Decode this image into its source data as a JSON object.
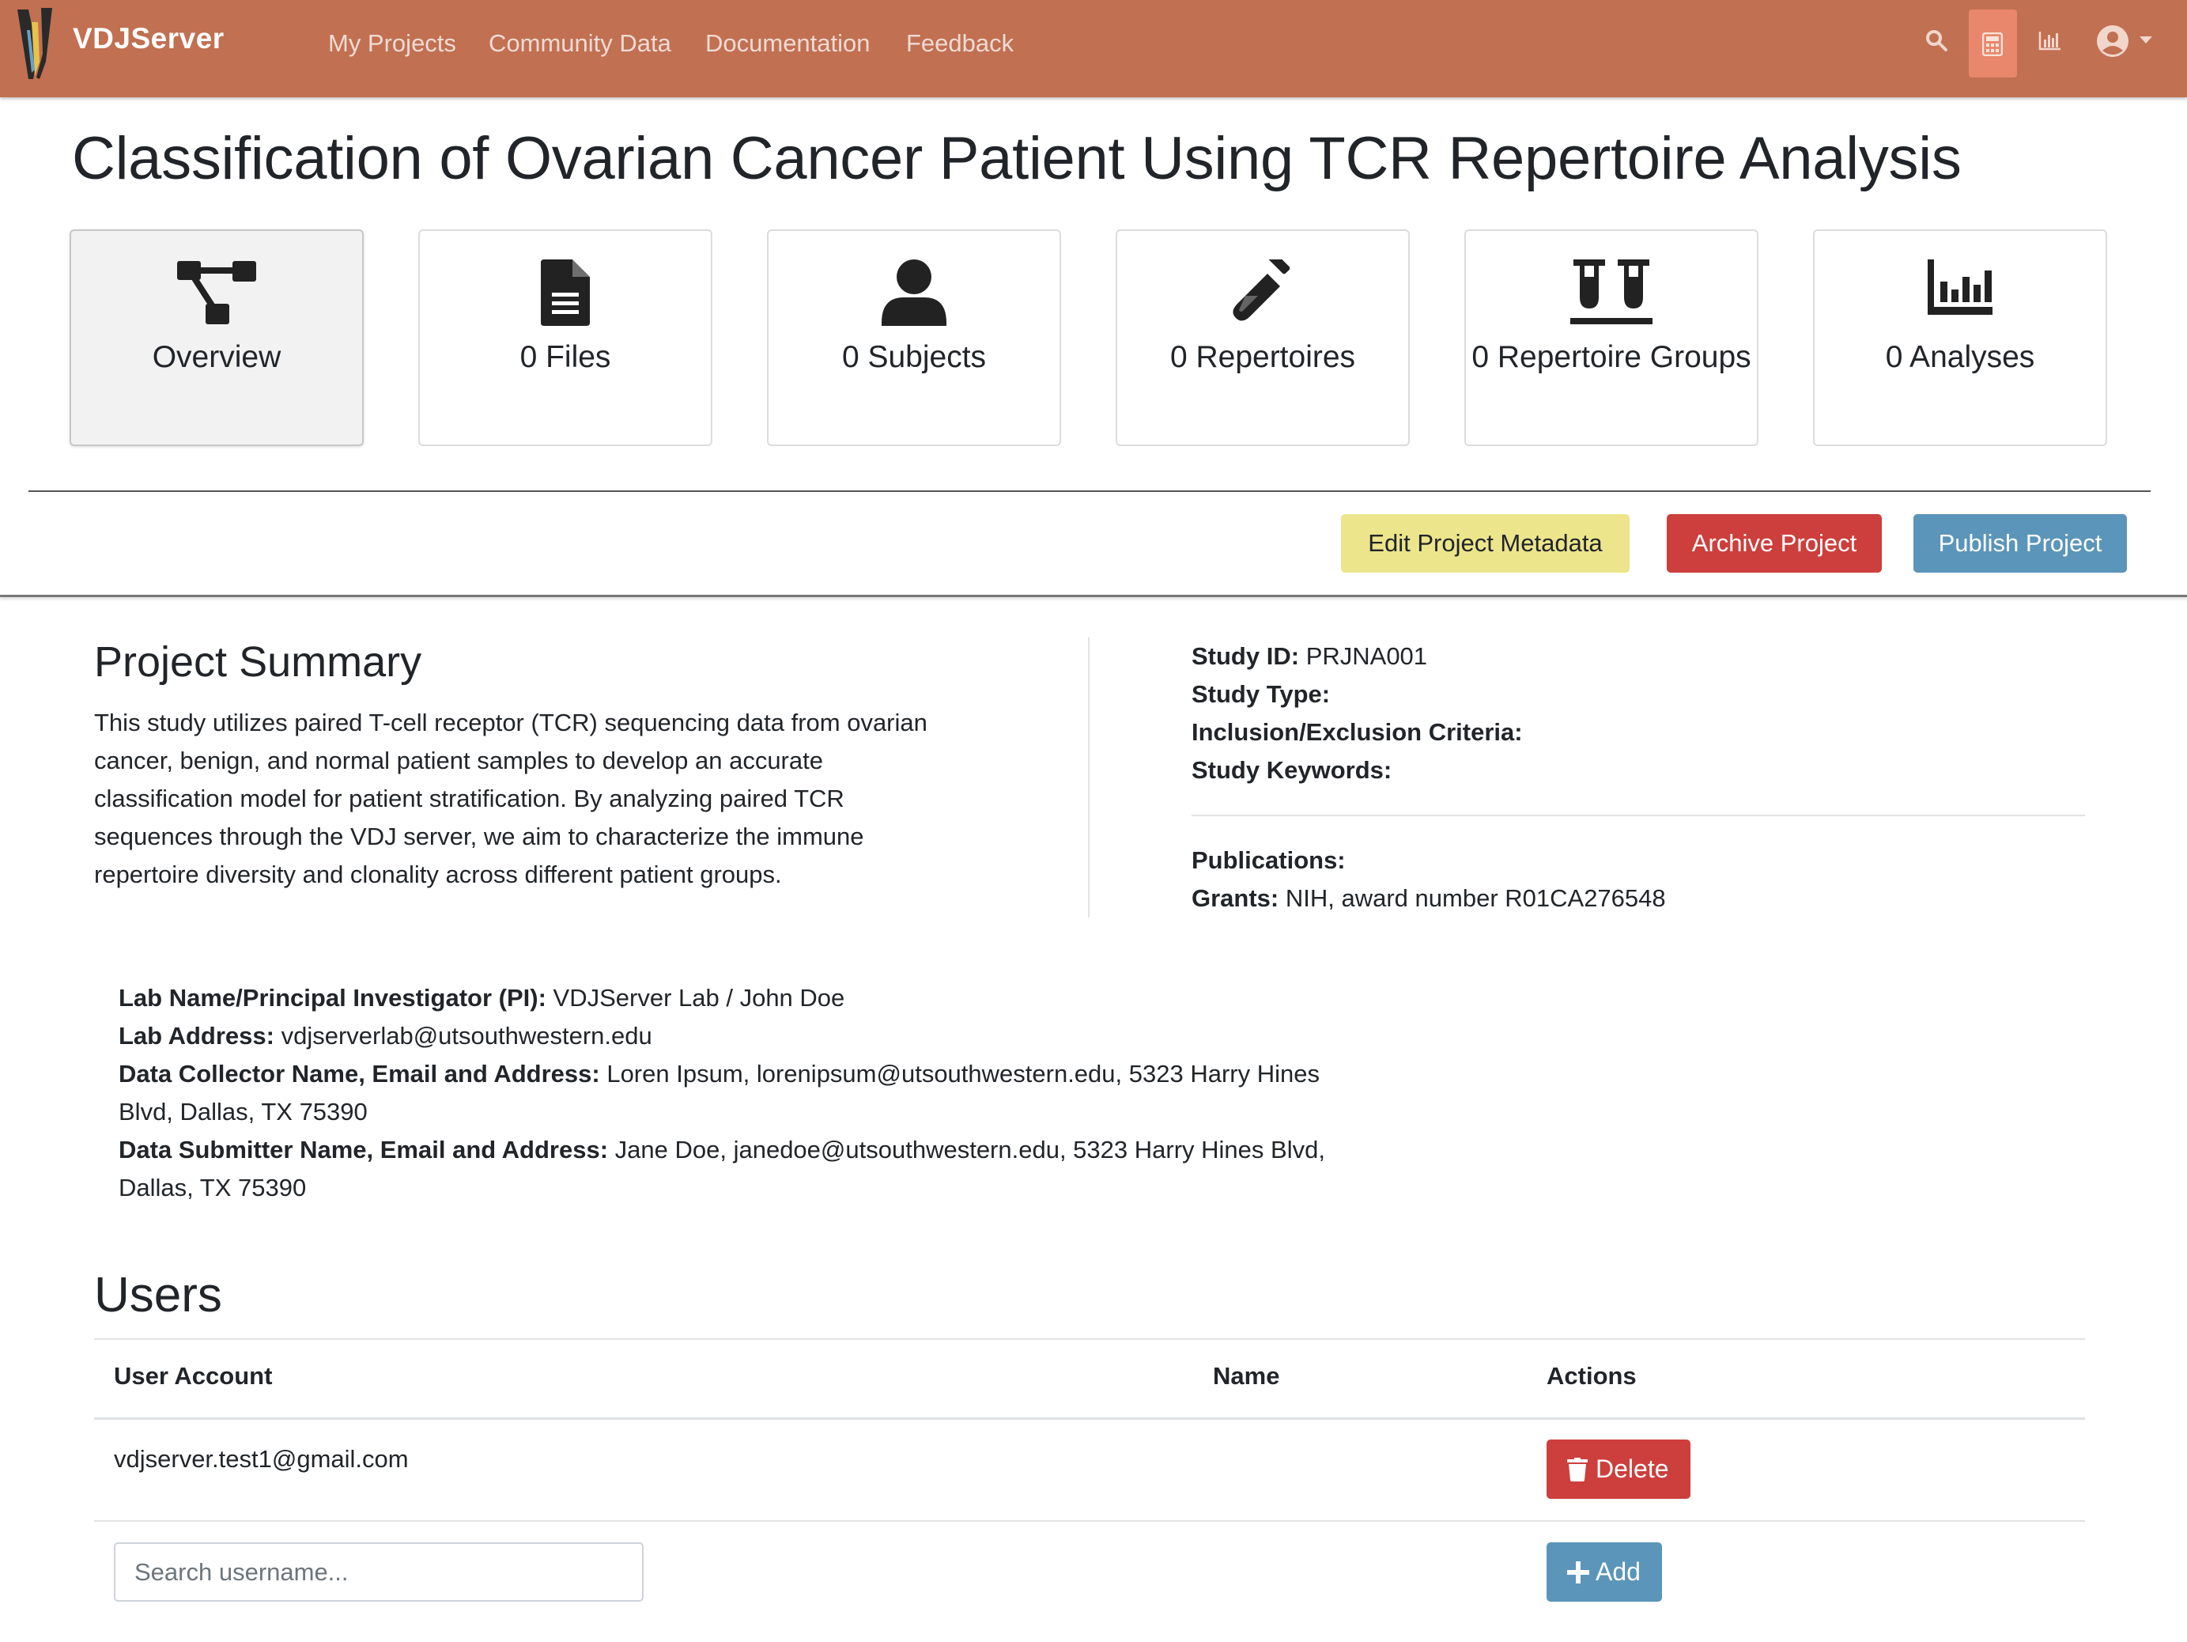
{
  "nav": {
    "brand": "VDJServer",
    "links": [
      "My Projects",
      "Community Data",
      "Documentation",
      "Feedback"
    ]
  },
  "title": "Classification of Ovarian Cancer Patient Using TCR Repertoire Analysis",
  "cards": [
    {
      "label": "Overview",
      "icon": "overview-icon"
    },
    {
      "label": "0 Files",
      "icon": "file-icon"
    },
    {
      "label": "0 Subjects",
      "icon": "user-icon"
    },
    {
      "label": "0 Repertoires",
      "icon": "test-tube-icon"
    },
    {
      "label": "0 Repertoire Groups",
      "icon": "test-tubes-icon"
    },
    {
      "label": "0 Analyses",
      "icon": "bar-chart-icon"
    }
  ],
  "actions": {
    "edit": "Edit Project Metadata",
    "archive": "Archive Project",
    "publish": "Publish Project"
  },
  "summary": {
    "heading": "Project Summary",
    "lines": [
      "This study utilizes paired T-cell receptor (TCR) sequencing data from ovarian",
      "cancer, benign, and normal patient samples to develop an accurate",
      "classification model for patient stratification. By analyzing paired TCR",
      "sequences through the VDJ server, we aim to characterize the immune",
      "repertoire diversity and clonality across different patient groups."
    ]
  },
  "study": {
    "id_label": "Study ID:",
    "id_value": "PRJNA001",
    "type_label": "Study Type:",
    "criteria_label": "Inclusion/Exclusion Criteria:",
    "keywords_label": "Study Keywords:",
    "publications_label": "Publications:",
    "grants_label": "Grants:",
    "grants_value": "NIH, award number R01CA276548"
  },
  "lab": {
    "pi_label": "Lab Name/Principal Investigator (PI):",
    "pi_value": "VDJServer Lab / John Doe",
    "address_label": "Lab Address:",
    "address_value": "vdjserverlab@utsouthwestern.edu",
    "collector_label": "Data Collector Name, Email and Address:",
    "collector_value_1": "Loren Ipsum, lorenipsum@utsouthwestern.edu, 5323 Harry Hines",
    "collector_value_2": "Blvd, Dallas, TX 75390",
    "submitter_label": "Data Submitter Name, Email and Address:",
    "submitter_value_1": "Jane Doe, janedoe@utsouthwestern.edu, 5323 Harry Hines Blvd,",
    "submitter_value_2": "Dallas, TX 75390"
  },
  "users": {
    "heading": "Users",
    "columns": [
      "User Account",
      "Name",
      "Actions"
    ],
    "rows": [
      {
        "account": "vdjserver.test1@gmail.com",
        "name": ""
      }
    ],
    "delete_label": "Delete",
    "add_label": "Add",
    "search_placeholder": "Search username..."
  },
  "colors": {
    "navbar": "#c17052",
    "danger": "#cc3f3c",
    "primary": "#5b95b9",
    "warning": "#ece58c"
  }
}
